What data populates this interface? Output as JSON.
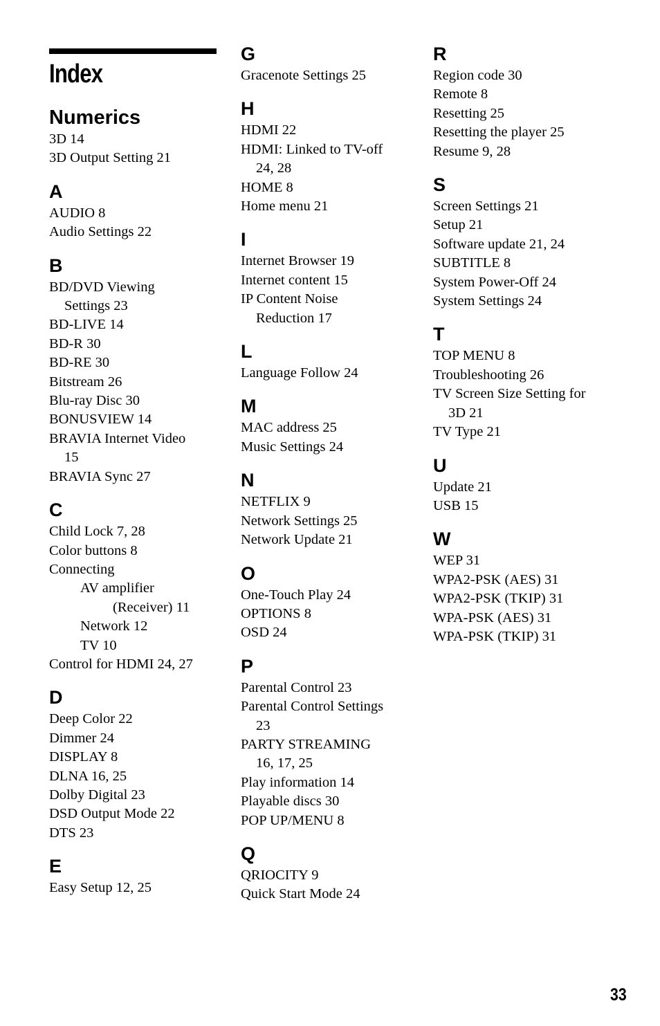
{
  "title": "Index",
  "page_number": "33",
  "columns": [
    [
      {
        "letter": "Numerics",
        "entries": [
          {
            "lines": [
              "3D 14"
            ]
          },
          {
            "lines": [
              "3D Output Setting 21"
            ]
          }
        ]
      },
      {
        "letter": "A",
        "entries": [
          {
            "lines": [
              "AUDIO 8"
            ]
          },
          {
            "lines": [
              "Audio Settings 22"
            ]
          }
        ]
      },
      {
        "letter": "B",
        "entries": [
          {
            "lines": [
              "BD/DVD Viewing",
              "Settings 23"
            ]
          },
          {
            "lines": [
              "BD-LIVE 14"
            ]
          },
          {
            "lines": [
              "BD-R 30"
            ]
          },
          {
            "lines": [
              "BD-RE 30"
            ]
          },
          {
            "lines": [
              "Bitstream 26"
            ]
          },
          {
            "lines": [
              "Blu-ray Disc 30"
            ]
          },
          {
            "lines": [
              "BONUSVIEW 14"
            ]
          },
          {
            "lines": [
              "BRAVIA Internet Video",
              "15"
            ]
          },
          {
            "lines": [
              "BRAVIA Sync 27"
            ]
          }
        ]
      },
      {
        "letter": "C",
        "entries": [
          {
            "lines": [
              "Child Lock 7, 28"
            ]
          },
          {
            "lines": [
              "Color buttons 8"
            ]
          },
          {
            "lines": [
              "Connecting"
            ]
          },
          {
            "lines": [
              "AV amplifier",
              "(Receiver) 11"
            ],
            "level": 1
          },
          {
            "lines": [
              "Network 12"
            ],
            "level": 1
          },
          {
            "lines": [
              "TV 10"
            ],
            "level": 1
          },
          {
            "lines": [
              "Control for HDMI 24, 27"
            ]
          }
        ]
      },
      {
        "letter": "D",
        "entries": [
          {
            "lines": [
              "Deep Color 22"
            ]
          },
          {
            "lines": [
              "Dimmer 24"
            ]
          },
          {
            "lines": [
              "DISPLAY 8"
            ]
          },
          {
            "lines": [
              "DLNA 16, 25"
            ]
          },
          {
            "lines": [
              "Dolby Digital 23"
            ]
          },
          {
            "lines": [
              "DSD Output Mode 22"
            ]
          },
          {
            "lines": [
              "DTS 23"
            ]
          }
        ]
      },
      {
        "letter": "E",
        "entries": [
          {
            "lines": [
              "Easy Setup 12, 25"
            ]
          }
        ]
      }
    ],
    [
      {
        "letter": "G",
        "entries": [
          {
            "lines": [
              "Gracenote Settings 25"
            ]
          }
        ]
      },
      {
        "letter": "H",
        "entries": [
          {
            "lines": [
              "HDMI 22"
            ]
          },
          {
            "lines": [
              "HDMI: Linked to TV-off",
              "24, 28"
            ]
          },
          {
            "lines": [
              "HOME 8"
            ]
          },
          {
            "lines": [
              "Home menu 21"
            ]
          }
        ]
      },
      {
        "letter": "I",
        "entries": [
          {
            "lines": [
              "Internet Browser 19"
            ]
          },
          {
            "lines": [
              "Internet content 15"
            ]
          },
          {
            "lines": [
              "IP Content Noise",
              "Reduction 17"
            ]
          }
        ]
      },
      {
        "letter": "L",
        "entries": [
          {
            "lines": [
              "Language Follow 24"
            ]
          }
        ]
      },
      {
        "letter": "M",
        "entries": [
          {
            "lines": [
              "MAC address 25"
            ]
          },
          {
            "lines": [
              "Music Settings 24"
            ]
          }
        ]
      },
      {
        "letter": "N",
        "entries": [
          {
            "lines": [
              "NETFLIX 9"
            ]
          },
          {
            "lines": [
              "Network Settings 25"
            ]
          },
          {
            "lines": [
              "Network Update 21"
            ]
          }
        ]
      },
      {
        "letter": "O",
        "entries": [
          {
            "lines": [
              "One-Touch Play 24"
            ]
          },
          {
            "lines": [
              "OPTIONS 8"
            ]
          },
          {
            "lines": [
              "OSD 24"
            ]
          }
        ]
      },
      {
        "letter": "P",
        "entries": [
          {
            "lines": [
              "Parental Control 23"
            ]
          },
          {
            "lines": [
              "Parental Control Settings",
              "23"
            ]
          },
          {
            "lines": [
              "PARTY STREAMING",
              "16, 17, 25"
            ]
          },
          {
            "lines": [
              "Play information 14"
            ]
          },
          {
            "lines": [
              "Playable discs 30"
            ]
          },
          {
            "lines": [
              "POP UP/MENU 8"
            ]
          }
        ]
      },
      {
        "letter": "Q",
        "entries": [
          {
            "lines": [
              "QRIOCITY 9"
            ]
          },
          {
            "lines": [
              "Quick Start Mode 24"
            ]
          }
        ]
      }
    ],
    [
      {
        "letter": "R",
        "entries": [
          {
            "lines": [
              "Region code 30"
            ]
          },
          {
            "lines": [
              "Remote 8"
            ]
          },
          {
            "lines": [
              "Resetting 25"
            ]
          },
          {
            "lines": [
              "Resetting the player 25"
            ]
          },
          {
            "lines": [
              "Resume 9, 28"
            ]
          }
        ]
      },
      {
        "letter": "S",
        "entries": [
          {
            "lines": [
              "Screen Settings 21"
            ]
          },
          {
            "lines": [
              "Setup 21"
            ]
          },
          {
            "lines": [
              "Software update 21, 24"
            ]
          },
          {
            "lines": [
              "SUBTITLE 8"
            ]
          },
          {
            "lines": [
              "System Power-Off 24"
            ]
          },
          {
            "lines": [
              "System Settings 24"
            ]
          }
        ]
      },
      {
        "letter": "T",
        "entries": [
          {
            "lines": [
              "TOP MENU 8"
            ]
          },
          {
            "lines": [
              "Troubleshooting 26"
            ]
          },
          {
            "lines": [
              "TV Screen Size Setting for",
              "3D 21"
            ]
          },
          {
            "lines": [
              "TV Type 21"
            ]
          }
        ]
      },
      {
        "letter": "U",
        "entries": [
          {
            "lines": [
              "Update 21"
            ]
          },
          {
            "lines": [
              "USB 15"
            ]
          }
        ]
      },
      {
        "letter": "W",
        "entries": [
          {
            "lines": [
              "WEP 31"
            ]
          },
          {
            "lines": [
              "WPA2-PSK (AES) 31"
            ]
          },
          {
            "lines": [
              "WPA2-PSK (TKIP) 31"
            ]
          },
          {
            "lines": [
              "WPA-PSK (AES) 31"
            ]
          },
          {
            "lines": [
              "WPA-PSK (TKIP) 31"
            ]
          }
        ]
      }
    ]
  ]
}
